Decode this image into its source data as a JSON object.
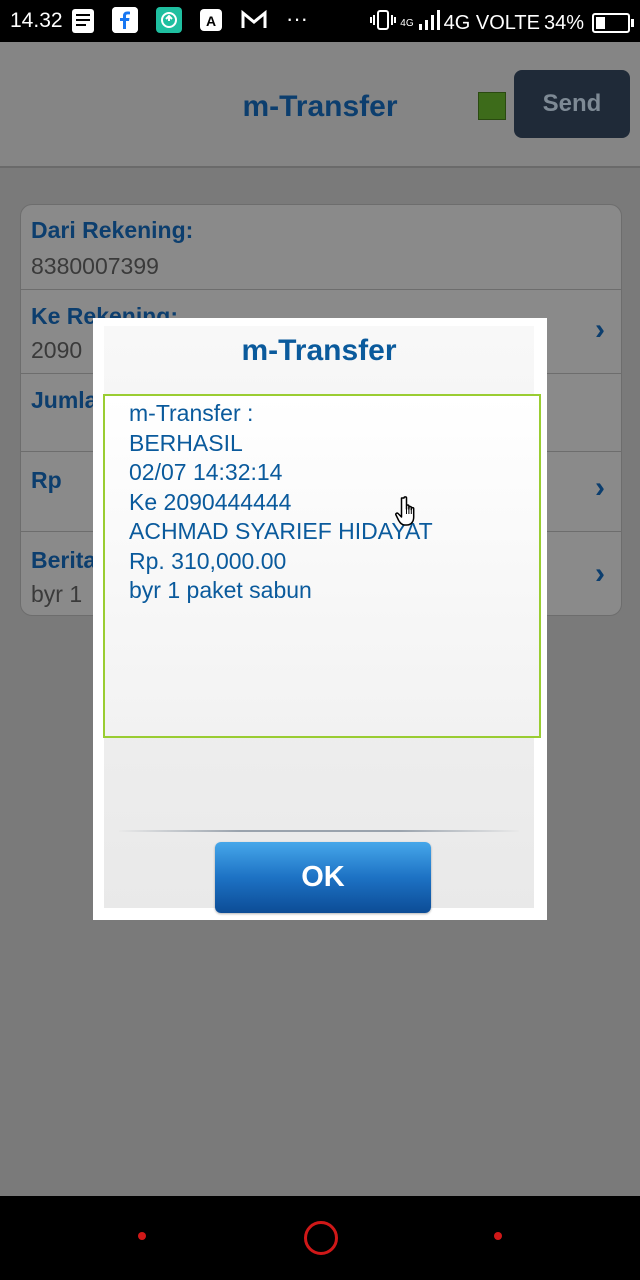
{
  "status_bar": {
    "time": "14.32",
    "network": "4G VOLTE",
    "network_small": "4G",
    "battery": "34%",
    "more": "···"
  },
  "header": {
    "title": "m-Transfer",
    "send_label": "Send",
    "indicator_color": "#3d6b1a"
  },
  "form": {
    "rows": [
      {
        "label": "Dari Rekening:",
        "value": "8380007399"
      },
      {
        "label": "Ke Rekening:",
        "value": "2090"
      },
      {
        "label": "Jumlah",
        "value": ""
      },
      {
        "label": "Rp",
        "value": ""
      },
      {
        "label": "Berita",
        "value": "byr 1"
      }
    ]
  },
  "dialog": {
    "title": "m-Transfer",
    "message_lines": [
      "m-Transfer :",
      "BERHASIL",
      "02/07 14:32:14",
      "Ke 2090444444",
      "ACHMAD SYARIEF HIDAYAT",
      "Rp. 310,000.00",
      "byr 1 paket sabun"
    ],
    "ok_label": "OK"
  },
  "colors": {
    "accent_blue": "#0a5a9c",
    "border_green": "#9acd32",
    "nav_red": "#d01818"
  }
}
